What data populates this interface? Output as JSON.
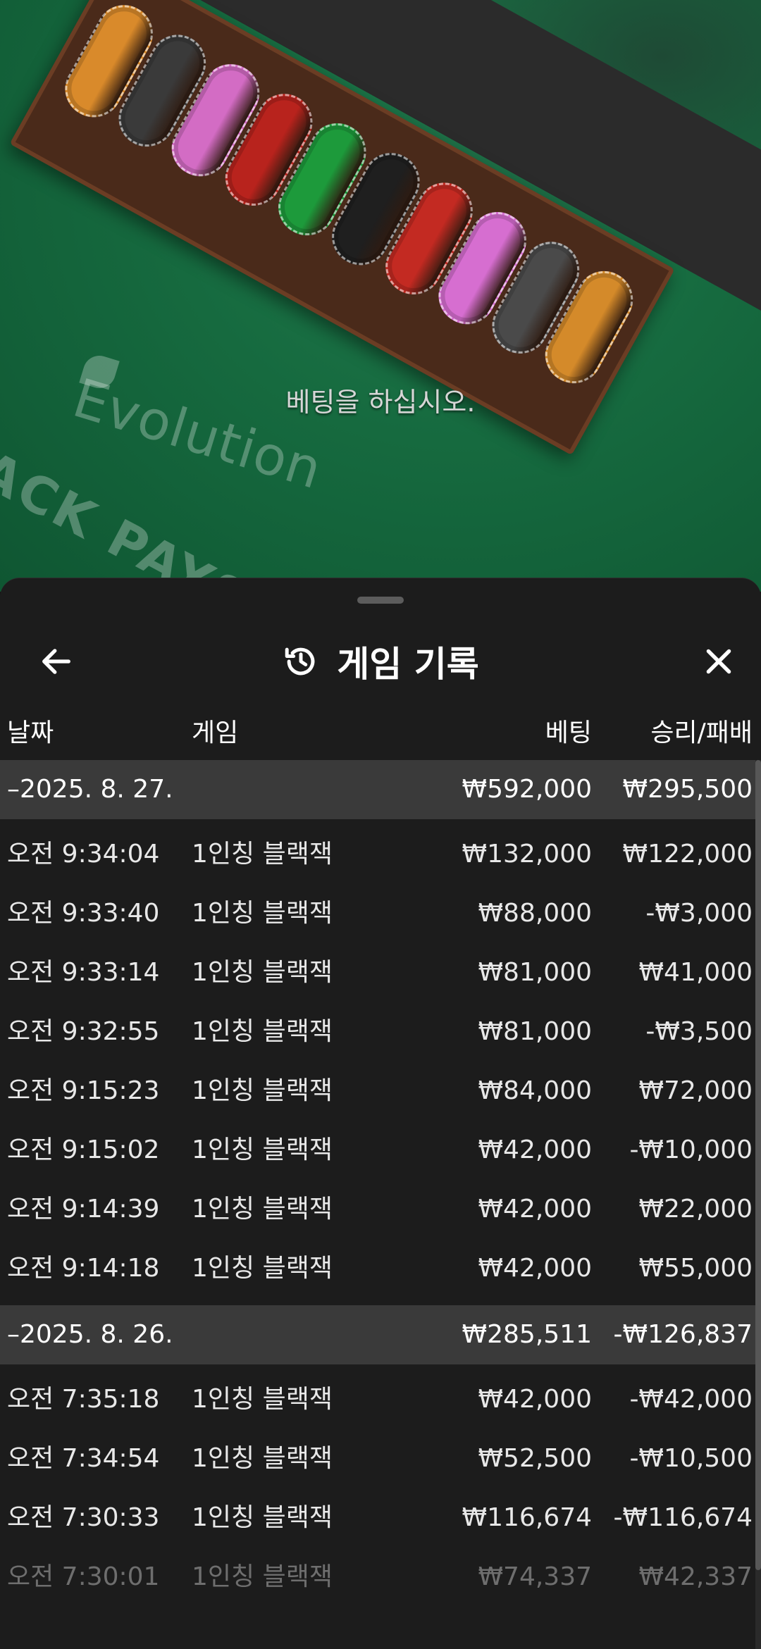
{
  "table": {
    "prompt": "베팅을 하십시오.",
    "brand": "Evolution",
    "felt_text": "JACK PAYS"
  },
  "chip_colors": [
    "#d98a2b",
    "#3a3a3a",
    "#d36cc4",
    "#b8231d",
    "#1d9a3b",
    "#1f1f1f",
    "#c32a22",
    "#d66ed0",
    "#4a4a4a",
    "#d48a2a"
  ],
  "sheet": {
    "title": "게임 기록",
    "back_icon": "arrow-left-icon",
    "history_icon": "history-icon",
    "close_icon": "close-icon"
  },
  "columns": {
    "date": "날짜",
    "game": "게임",
    "bet": "베팅",
    "win_loss": "승리/패배"
  },
  "groups": [
    {
      "date": "–2025. 8. 27.",
      "bet_total": "₩592,000",
      "result_total": "₩295,500",
      "rows": [
        {
          "time": "오전 9:34:04",
          "game": "1인칭 블랙잭",
          "bet": "₩132,000",
          "result": "₩122,000"
        },
        {
          "time": "오전 9:33:40",
          "game": "1인칭 블랙잭",
          "bet": "₩88,000",
          "result": "-₩3,000"
        },
        {
          "time": "오전 9:33:14",
          "game": "1인칭 블랙잭",
          "bet": "₩81,000",
          "result": "₩41,000"
        },
        {
          "time": "오전 9:32:55",
          "game": "1인칭 블랙잭",
          "bet": "₩81,000",
          "result": "-₩3,500"
        },
        {
          "time": "오전 9:15:23",
          "game": "1인칭 블랙잭",
          "bet": "₩84,000",
          "result": "₩72,000"
        },
        {
          "time": "오전 9:15:02",
          "game": "1인칭 블랙잭",
          "bet": "₩42,000",
          "result": "-₩10,000"
        },
        {
          "time": "오전 9:14:39",
          "game": "1인칭 블랙잭",
          "bet": "₩42,000",
          "result": "₩22,000"
        },
        {
          "time": "오전 9:14:18",
          "game": "1인칭 블랙잭",
          "bet": "₩42,000",
          "result": "₩55,000"
        }
      ]
    },
    {
      "date": "–2025. 8. 26.",
      "bet_total": "₩285,511",
      "result_total": "-₩126,837",
      "rows": [
        {
          "time": "오전 7:35:18",
          "game": "1인칭 블랙잭",
          "bet": "₩42,000",
          "result": "-₩42,000"
        },
        {
          "time": "오전 7:34:54",
          "game": "1인칭 블랙잭",
          "bet": "₩52,500",
          "result": "-₩10,500"
        },
        {
          "time": "오전 7:30:33",
          "game": "1인칭 블랙잭",
          "bet": "₩116,674",
          "result": "-₩116,674"
        },
        {
          "time": "오전 7:30:01",
          "game": "1인칭 블랙잭",
          "bet": "₩74,337",
          "result": "₩42,337"
        }
      ]
    }
  ]
}
